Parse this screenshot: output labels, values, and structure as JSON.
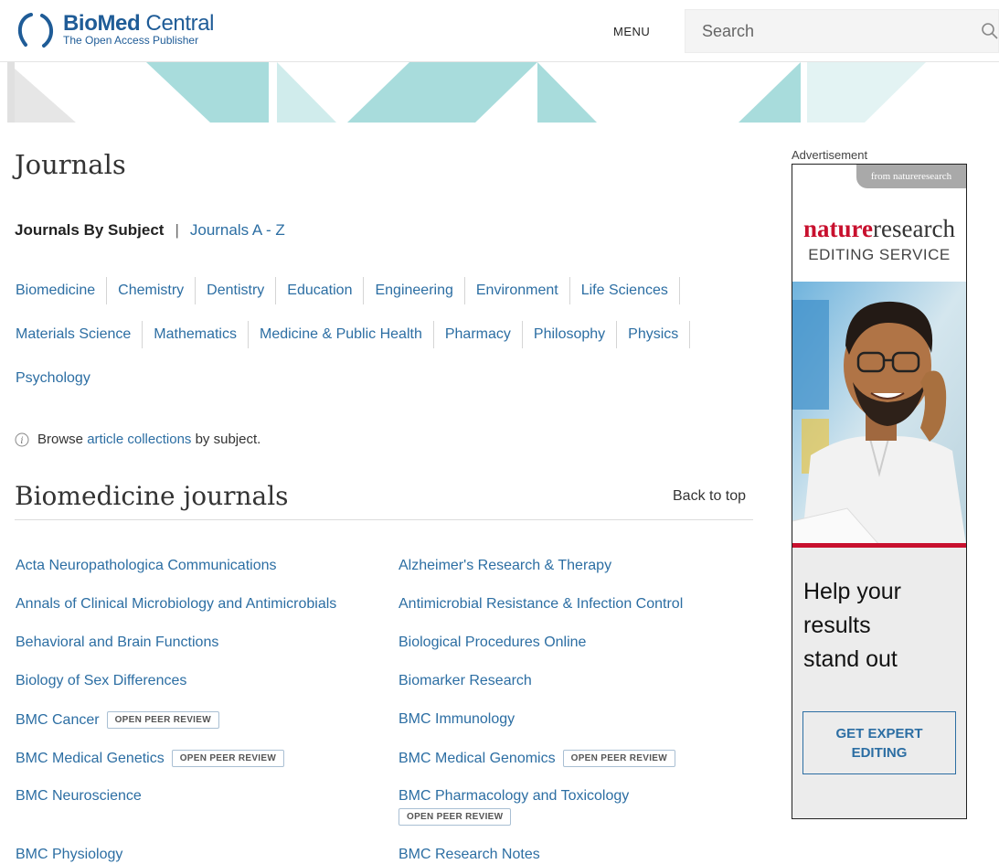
{
  "header": {
    "logo_bio": "Bio",
    "logo_med": "Med",
    "logo_central": " Central",
    "logo_tagline": "The Open Access Publisher",
    "menu_label": "MENU",
    "search_placeholder": "Search"
  },
  "page": {
    "title": "Journals",
    "subnav_active": "Journals By Subject",
    "subnav_sep": "|",
    "subnav_link": "Journals A - Z"
  },
  "subjects": {
    "row1": [
      "Biomedicine",
      "Chemistry",
      "Dentistry",
      "Education",
      "Engineering",
      "Environment",
      "Life Sciences"
    ],
    "row2": [
      "Materials Science",
      "Mathematics",
      "Medicine & Public Health",
      "Pharmacy",
      "Philosophy",
      "Physics"
    ],
    "row3": [
      "Psychology"
    ]
  },
  "info": {
    "before": "Browse ",
    "link": "article collections",
    "after": " by subject."
  },
  "section": {
    "title": "Biomedicine journals",
    "back_to_top": "Back to top",
    "badge_label": "OPEN PEER REVIEW",
    "journals": [
      {
        "name": "Acta Neuropathologica Communications",
        "badge": false
      },
      {
        "name": "Alzheimer's Research & Therapy",
        "badge": false
      },
      {
        "name": "Annals of Clinical Microbiology and Antimicrobials",
        "badge": false
      },
      {
        "name": "Antimicrobial Resistance & Infection Control",
        "badge": false
      },
      {
        "name": "Behavioral and Brain Functions",
        "badge": false
      },
      {
        "name": "Biological Procedures Online",
        "badge": false
      },
      {
        "name": "Biology of Sex Differences",
        "badge": false
      },
      {
        "name": "Biomarker Research",
        "badge": false
      },
      {
        "name": "BMC Cancer",
        "badge": true
      },
      {
        "name": "BMC Immunology",
        "badge": false
      },
      {
        "name": "BMC Medical Genetics",
        "badge": true
      },
      {
        "name": "BMC Medical Genomics",
        "badge": true
      },
      {
        "name": "BMC Neuroscience",
        "badge": false
      },
      {
        "name": "BMC Pharmacology and Toxicology",
        "badge": true
      },
      {
        "name": "BMC Physiology",
        "badge": false
      },
      {
        "name": "BMC Research Notes",
        "badge": false
      }
    ]
  },
  "ad": {
    "label": "Advertisement",
    "tag": "from natureresearch",
    "brand_nature": "nature",
    "brand_research": "research",
    "subtitle": "EDITING SERVICE",
    "headline_lines": [
      "Help your",
      "results",
      "stand out"
    ],
    "cta_line1": "GET EXPERT",
    "cta_line2": "EDITING"
  },
  "colors": {
    "link": "#2c6ea3",
    "brand": "#1f5c97",
    "nature_red": "#c8102e",
    "banner_teal": "#a8dcdc"
  }
}
